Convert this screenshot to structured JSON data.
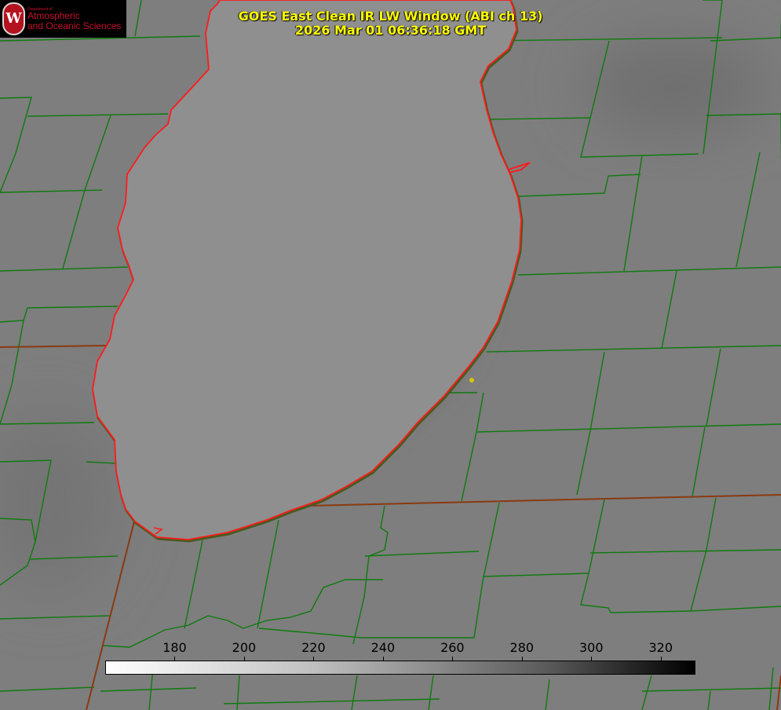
{
  "title": {
    "line1": "GOES East Clean IR LW Window (ABI ch 13)",
    "line2": "2026 Mar 01 06:36:18 GMT"
  },
  "logo": {
    "seal_letter": "W",
    "department": "Department of",
    "line1": "Atmospheric",
    "line2": "and Oceanic Sciences"
  },
  "colorbar": {
    "min": 160,
    "max": 330,
    "ticks": [
      "180",
      "200",
      "220",
      "240",
      "260",
      "280",
      "300",
      "320"
    ]
  },
  "colors": {
    "shoreline": "#ff1a1a",
    "county_lines": "#0f7a0f",
    "state_lines": "#8a3a10",
    "title": "#ffff00",
    "marker": "#d8c400"
  }
}
